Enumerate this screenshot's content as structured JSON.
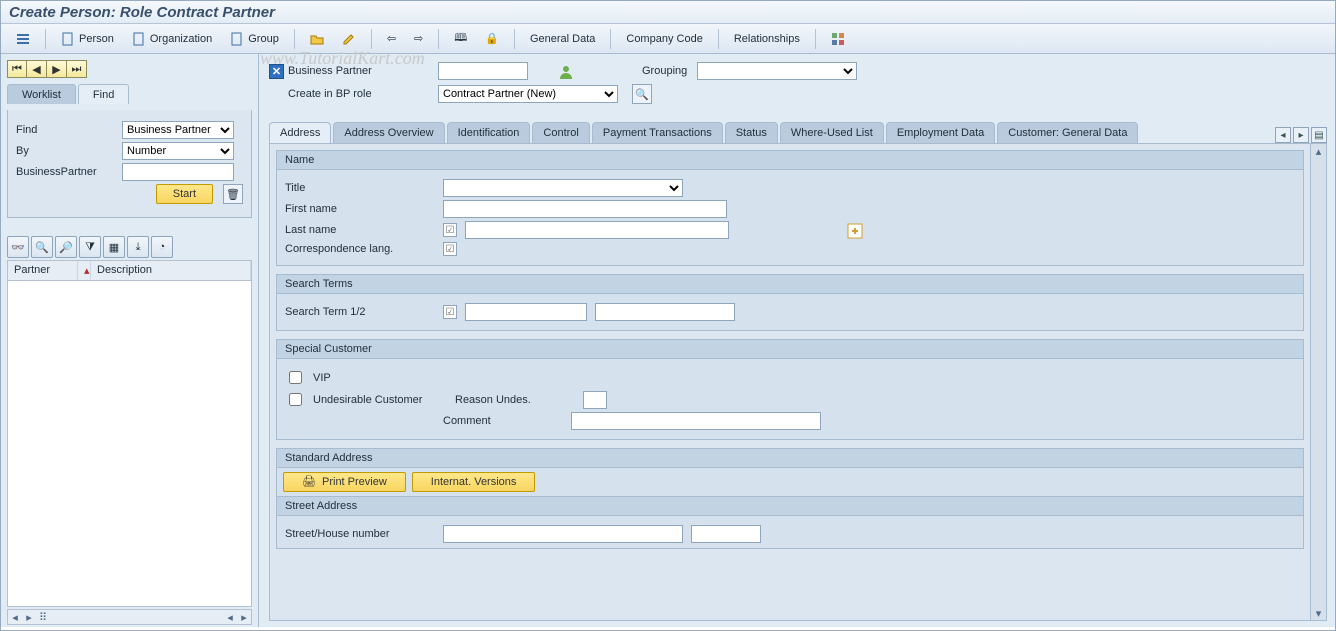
{
  "title": "Create Person: Role Contract Partner",
  "toolbar": {
    "person": "Person",
    "organization": "Organization",
    "group": "Group",
    "general_data": "General Data",
    "company_code": "Company Code",
    "relationships": "Relationships"
  },
  "left": {
    "tabs": {
      "worklist": "Worklist",
      "find": "Find"
    },
    "find_label": "Find",
    "by_label": "By",
    "bp_label": "BusinessPartner",
    "find_value": "Business Partner",
    "by_value": "Number",
    "start": "Start",
    "cols": {
      "partner": "Partner",
      "description": "Description"
    }
  },
  "bp_header": {
    "bp_label": "Business Partner",
    "grouping_label": "Grouping",
    "role_label": "Create in BP role",
    "role_value": "Contract Partner (New)"
  },
  "tabs": [
    "Address",
    "Address Overview",
    "Identification",
    "Control",
    "Payment Transactions",
    "Status",
    "Where-Used List",
    "Employment Data",
    "Customer: General Data"
  ],
  "groups": {
    "name": {
      "title": "Name",
      "title_lbl": "Title",
      "first_lbl": "First name",
      "last_lbl": "Last name",
      "lang_lbl": "Correspondence lang."
    },
    "search": {
      "title": "Search Terms",
      "term_lbl": "Search Term 1/2"
    },
    "special": {
      "title": "Special Customer",
      "vip": "VIP",
      "undes": "Undesirable Customer",
      "reason": "Reason Undes.",
      "comment": "Comment"
    },
    "address": {
      "title": "Standard Address",
      "print": "Print Preview",
      "intl": "Internat. Versions",
      "street_title": "Street Address",
      "street_lbl": "Street/House number"
    }
  },
  "watermark": "www.TutorialKart.com"
}
